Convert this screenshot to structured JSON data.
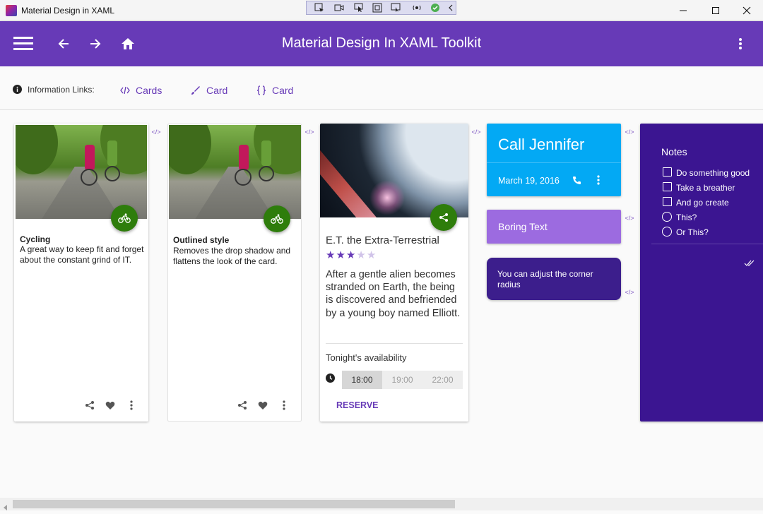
{
  "window": {
    "title": "Material Design in XAML",
    "minimize": "—",
    "maximize": "☐",
    "close": "✕"
  },
  "debug_toolbar": {
    "icons": [
      "select-element-icon",
      "record-icon",
      "pointer-icon",
      "focus-icon",
      "layout-icon",
      "hot-reload-icon",
      "check-icon",
      "collapse-icon"
    ]
  },
  "appbar": {
    "title": "Material Design In XAML Toolkit",
    "background": "#673ab7"
  },
  "info_links": {
    "label": "Information Links:",
    "links": [
      {
        "label": "Cards",
        "icon": "code-icon"
      },
      {
        "label": "Card",
        "icon": "brush-icon"
      },
      {
        "label": "Card",
        "icon": "braces-icon"
      }
    ]
  },
  "cards": {
    "cycling": {
      "title": "Cycling",
      "text": "A great way to keep fit and forget about the constant grind of IT."
    },
    "outlined": {
      "title": "Outlined style",
      "text": "Removes the drop shadow and flattens the look of the card."
    },
    "movie": {
      "title": "E.T. the Extra-Terrestrial",
      "rating": 3,
      "rating_max": 5,
      "description": "After a gentle alien becomes stranded on Earth, the being is discovered and befriended by a young boy named Elliott.",
      "availability_label": "Tonight's availability",
      "times": [
        "18:00",
        "19:00",
        "22:00"
      ],
      "selected_time": "18:00",
      "action": "RESERVE"
    },
    "call": {
      "title": "Call Jennifer",
      "date": "March 19, 2016",
      "background": "#03a9f4"
    },
    "boring": {
      "text": "Boring Text",
      "background": "#9c6be0"
    },
    "corner": {
      "text": "You can adjust the corner radius",
      "background": "#3c1e8c"
    },
    "notes": {
      "title": "Notes",
      "checkboxes": [
        "Do something good",
        "Take a breather",
        "And go create"
      ],
      "radios": [
        "This?",
        "Or This?"
      ],
      "background": "#3b1591"
    }
  },
  "colors": {
    "accent": "#673ab7",
    "fab": "#2e7d0b"
  }
}
